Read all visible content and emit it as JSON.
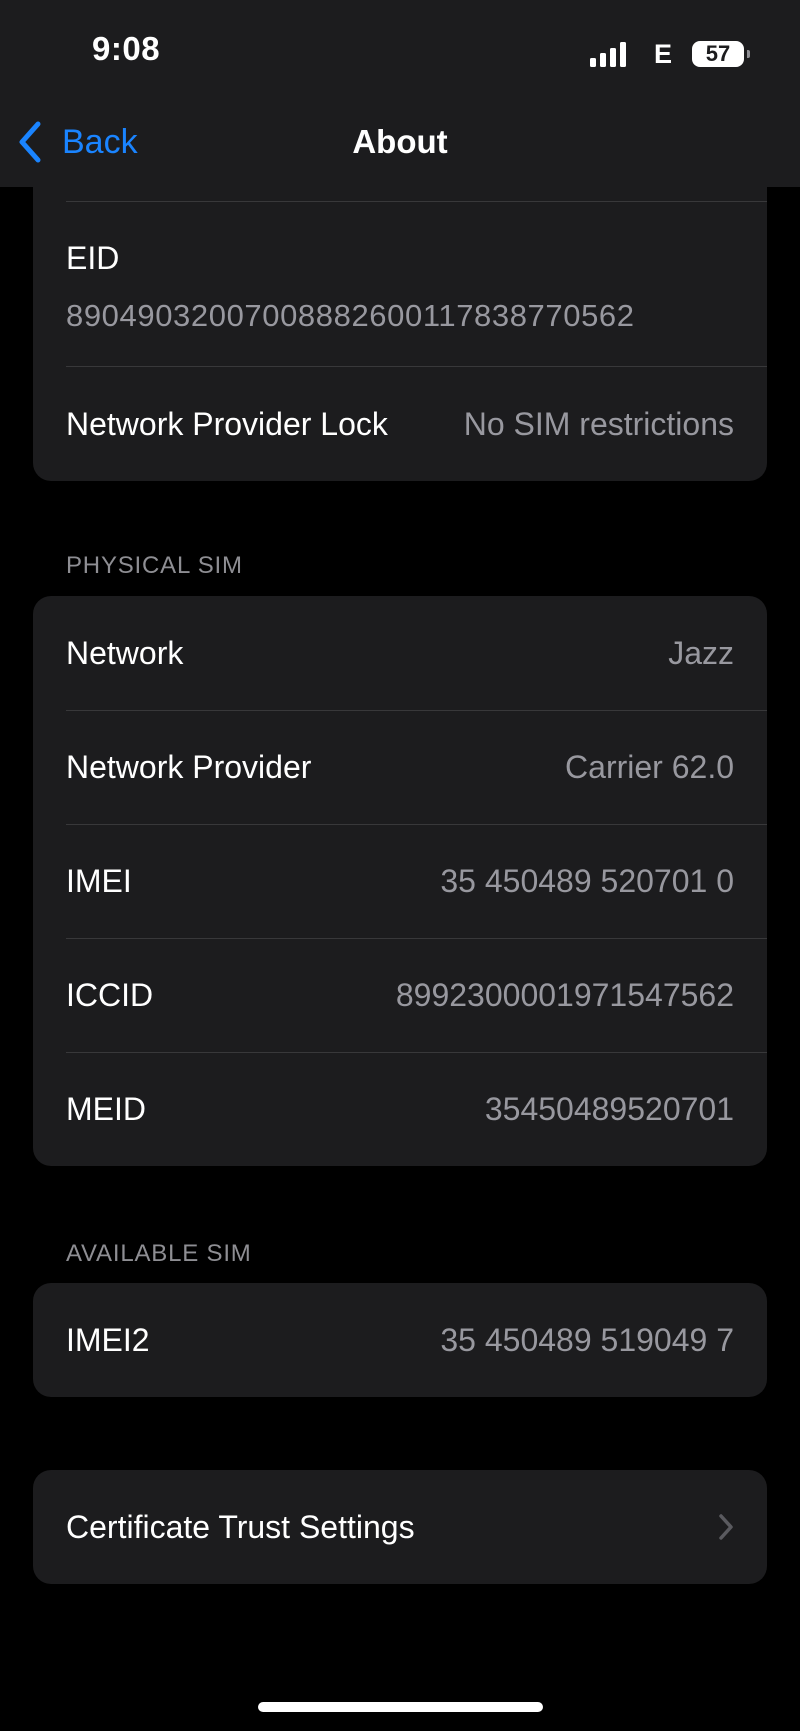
{
  "status_bar": {
    "time": "9:08",
    "network_type": "E",
    "battery_level": "57",
    "icons": [
      "signal-icon",
      "battery-icon"
    ]
  },
  "nav": {
    "back_label": "Back",
    "title": "About",
    "accent_color": "#1a84ff"
  },
  "top_card": {
    "eid_label": "EID",
    "eid_value": "89049032007008882600117838770562",
    "lock_label": "Network Provider Lock",
    "lock_value": "No SIM restrictions"
  },
  "physical_sim": {
    "header": "PHYSICAL SIM",
    "rows": [
      {
        "label": "Network",
        "value": "Jazz"
      },
      {
        "label": "Network Provider",
        "value": "Carrier 62.0"
      },
      {
        "label": "IMEI",
        "value": "35 450489 520701 0"
      },
      {
        "label": "ICCID",
        "value": "8992300001971547562"
      },
      {
        "label": "MEID",
        "value": "35450489520701"
      }
    ]
  },
  "available_sim": {
    "header": "AVAILABLE SIM",
    "rows": [
      {
        "label": "IMEI2",
        "value": "35 450489 519049 7"
      }
    ]
  },
  "certificate": {
    "label": "Certificate Trust Settings",
    "icon": "chevron-right-icon"
  },
  "colors": {
    "background": "#000000",
    "card": "#1c1c1e",
    "secondary_text": "#98989f",
    "separator": "#38383a"
  }
}
